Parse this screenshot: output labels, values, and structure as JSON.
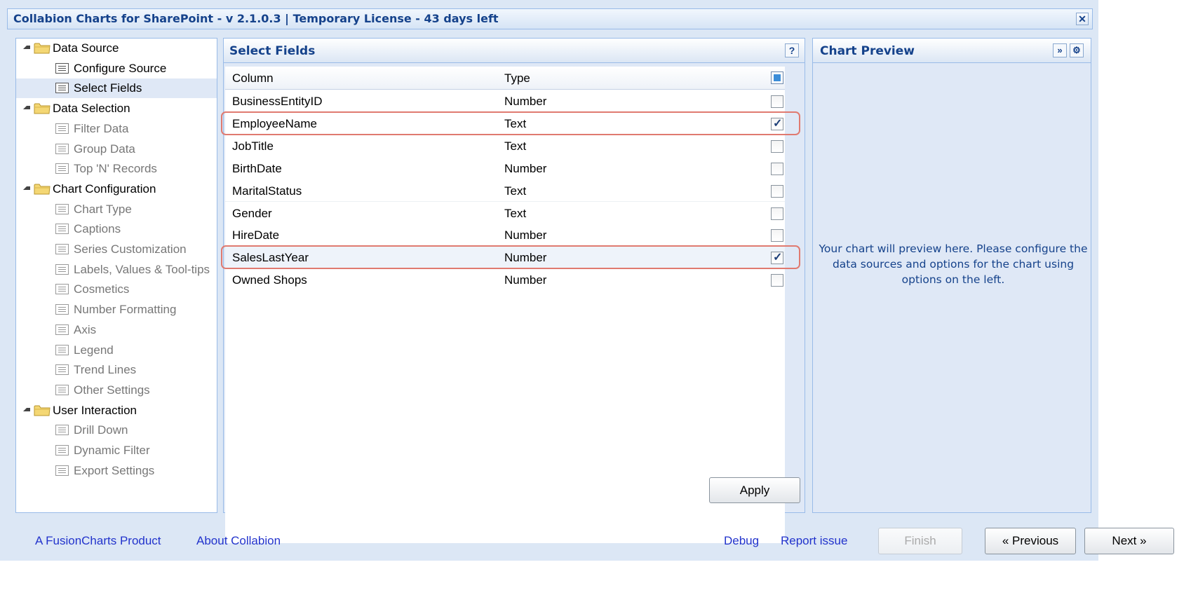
{
  "window": {
    "title": "Collabion Charts for SharePoint - v 2.1.0.3 | Temporary License - 43 days left",
    "close_glyph": "✕"
  },
  "nav": {
    "groups": [
      {
        "label": "Data Source",
        "items": [
          {
            "label": "Configure Source",
            "state": "enabled"
          },
          {
            "label": "Select Fields",
            "state": "selected"
          }
        ]
      },
      {
        "label": "Data Selection",
        "items": [
          {
            "label": "Filter Data",
            "state": "disabled"
          },
          {
            "label": "Group Data",
            "state": "disabled"
          },
          {
            "label": "Top 'N' Records",
            "state": "disabled"
          }
        ]
      },
      {
        "label": "Chart Configuration",
        "items": [
          {
            "label": "Chart Type",
            "state": "disabled"
          },
          {
            "label": "Captions",
            "state": "disabled"
          },
          {
            "label": "Series Customization",
            "state": "disabled"
          },
          {
            "label": "Labels, Values & Tool-tips",
            "state": "disabled"
          },
          {
            "label": "Cosmetics",
            "state": "disabled"
          },
          {
            "label": "Number Formatting",
            "state": "disabled"
          },
          {
            "label": "Axis",
            "state": "disabled"
          },
          {
            "label": "Legend",
            "state": "disabled"
          },
          {
            "label": "Trend Lines",
            "state": "disabled"
          },
          {
            "label": "Other Settings",
            "state": "disabled"
          }
        ]
      },
      {
        "label": "User Interaction",
        "items": [
          {
            "label": "Drill Down",
            "state": "disabled"
          },
          {
            "label": "Dynamic Filter",
            "state": "disabled"
          },
          {
            "label": "Export Settings",
            "state": "disabled"
          }
        ]
      }
    ]
  },
  "select_fields": {
    "title": "Select Fields",
    "help_glyph": "?",
    "columns": {
      "column": "Column",
      "type": "Type"
    },
    "rows": [
      {
        "column": "BusinessEntityID",
        "type": "Number",
        "checked": false
      },
      {
        "column": "EmployeeName",
        "type": "Text",
        "checked": true
      },
      {
        "column": "JobTitle",
        "type": "Text",
        "checked": false
      },
      {
        "column": "BirthDate",
        "type": "Number",
        "checked": false
      },
      {
        "column": "MaritalStatus",
        "type": "Text",
        "checked": false
      },
      {
        "column": "Gender",
        "type": "Text",
        "checked": false
      },
      {
        "column": "HireDate",
        "type": "Number",
        "checked": false
      },
      {
        "column": "SalesLastYear",
        "type": "Number",
        "checked": true
      },
      {
        "column": "Owned Shops",
        "type": "Number",
        "checked": false
      }
    ],
    "apply_label": "Apply"
  },
  "chart_preview": {
    "title": "Chart Preview",
    "expand_glyph": "»",
    "settings_glyph": "⚙",
    "message": "Your chart will preview here. Please configure the data sources and options for the chart using options on the left."
  },
  "footer": {
    "fusioncharts_link": "A FusionCharts Product",
    "about_link": "About Collabion",
    "debug_link": "Debug",
    "report_link": "Report issue",
    "finish_label": "Finish",
    "previous_label": "« Previous",
    "next_label": "Next »"
  },
  "colors": {
    "accent_title": "#15428b",
    "panel_border": "#99bbe8",
    "highlight_box": "#e07a70",
    "link": "#2233cc"
  }
}
